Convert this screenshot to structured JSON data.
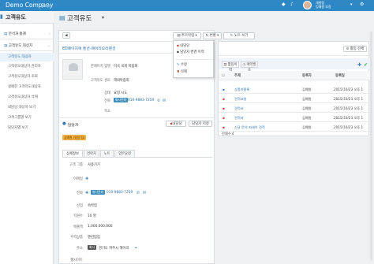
{
  "topbar": {
    "brand": "Demo Company",
    "user_line1": "개발팀",
    "user_line2": "김예원 부장"
  },
  "sidebar": {
    "title": "고객유도",
    "sections": [
      {
        "label": "분석과 통계"
      },
      {
        "label": "고객유도 대상자"
      }
    ],
    "items": [
      "고객유도 대상자",
      "고객유도대상자 관리자",
      "고객유도대상자 조회",
      "실패한 고객유도대상자",
      "고객유도대상자 삭제",
      "내담당 대상자 보기",
      "고객그룹별 보기",
      "담당자별 보기"
    ]
  },
  "header": {
    "title": "고객유도",
    "caret": "▾"
  },
  "toolbar": {
    "back": "◀",
    "add_label": "추가작업",
    "change_label": "변환",
    "note_label": "노트 쓰기"
  },
  "menu": {
    "items": [
      "내담당",
      "담당자 변경 이력",
      "수정",
      "삭제"
    ]
  },
  "record": {
    "title": "ED페이지에 펜션-페이리모리펜션",
    "fields": [
      {
        "label": "한페이지 업명",
        "value": "미국 국회 박람회"
      },
      {
        "label": "고객유도 경로",
        "value": "해외박람회"
      },
      {
        "label": "상태",
        "value": "요청 시도"
      },
      {
        "label": "전화",
        "badge": "회사전화",
        "value": "010-9883-7259"
      },
      {
        "label": "목소",
        "value": ""
      }
    ]
  },
  "owner": {
    "section_label": "담당자",
    "btn1": "내담당",
    "btn2": "담당자 지정",
    "tag": "김예원 (영업 팀)"
  },
  "tabs": [
    "상세정보",
    "연락처",
    "노트",
    "업무요청"
  ],
  "detail": {
    "fields": [
      {
        "label": "고객 그룹",
        "value": "사용기기"
      },
      {
        "label": "이메일",
        "value": ""
      },
      {
        "label": "전화",
        "badge": "회사전화",
        "value": "010-9883-7259"
      },
      {
        "label": "산업",
        "value": "숙박업"
      },
      {
        "label": "직원수",
        "value": "10 명"
      },
      {
        "label": "매출액",
        "value": "1,000,000,000"
      },
      {
        "label": "주력상품",
        "value": "펜션업업"
      },
      {
        "label": "주소",
        "badge": "회사",
        "value": "경기도 파주시 헤이리"
      },
      {
        "label": "웹사이트",
        "value": ""
      }
    ]
  },
  "activity": {
    "btn_all": "활동 전체",
    "tabs": [
      "활동이력",
      "예약발송"
    ],
    "columns": [
      "주제",
      "등록자",
      "등록일"
    ],
    "rows": [
      {
        "subject": "상품카탈록",
        "author": "김예원",
        "date": "2015/10/23 오후 1"
      },
      {
        "subject": "견적요청",
        "author": "김예원",
        "date": "2015/10/23 오후 1"
      },
      {
        "subject": "견적서",
        "author": "김예원",
        "date": "2015/10/23 오후 1"
      },
      {
        "subject": "견적서",
        "author": "김예원",
        "date": "2015/10/23 오후 1"
      },
      {
        "subject": "신규 문의 자세히 견적",
        "author": "김예원",
        "date": "2015/10/23 오후 1"
      }
    ],
    "total": "전체수 4"
  },
  "colors": {
    "brand": "#2f88c6",
    "link": "#2a6ea8",
    "phone_badge": "#3c8dbc",
    "delete": "#c0392b"
  }
}
